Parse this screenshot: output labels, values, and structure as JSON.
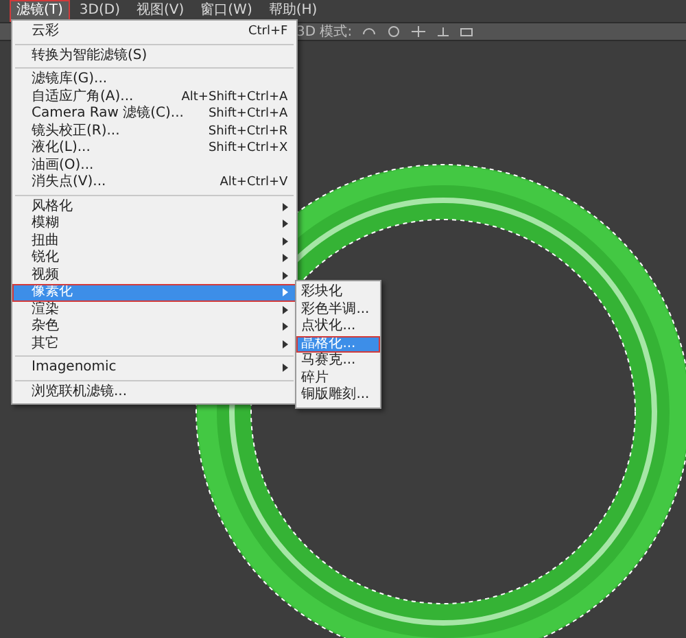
{
  "menubar": [
    {
      "label": "滤镜(T)",
      "selected": true,
      "marked": true
    },
    {
      "label": "3D(D)",
      "selected": false,
      "marked": false
    },
    {
      "label": "视图(V)",
      "selected": false,
      "marked": false
    },
    {
      "label": "窗口(W)",
      "selected": false,
      "marked": false
    },
    {
      "label": "帮助(H)",
      "selected": false,
      "marked": false
    }
  ],
  "toolbar": {
    "label": "3D 模式:"
  },
  "filter_menu": {
    "items": [
      {
        "kind": "item",
        "label": "云彩",
        "shortcut": "Ctrl+F",
        "selected": false,
        "marked": false
      },
      {
        "kind": "separator"
      },
      {
        "kind": "item",
        "label": "转换为智能滤镜(S)",
        "selected": false,
        "marked": false
      },
      {
        "kind": "separator"
      },
      {
        "kind": "item",
        "label": "滤镜库(G)...",
        "selected": false,
        "marked": false
      },
      {
        "kind": "item",
        "label": "自适应广角(A)...",
        "shortcut": "Alt+Shift+Ctrl+A",
        "selected": false,
        "marked": false
      },
      {
        "kind": "item",
        "label": "Camera Raw 滤镜(C)...",
        "shortcut": "Shift+Ctrl+A",
        "selected": false,
        "marked": false
      },
      {
        "kind": "item",
        "label": "镜头校正(R)...",
        "shortcut": "Shift+Ctrl+R",
        "selected": false,
        "marked": false
      },
      {
        "kind": "item",
        "label": "液化(L)...",
        "shortcut": "Shift+Ctrl+X",
        "selected": false,
        "marked": false
      },
      {
        "kind": "item",
        "label": "油画(O)...",
        "selected": false,
        "marked": false
      },
      {
        "kind": "item",
        "label": "消失点(V)...",
        "shortcut": "Alt+Ctrl+V",
        "selected": false,
        "marked": false
      },
      {
        "kind": "separator"
      },
      {
        "kind": "submenu",
        "label": "风格化",
        "selected": false,
        "marked": false
      },
      {
        "kind": "submenu",
        "label": "模糊",
        "selected": false,
        "marked": false
      },
      {
        "kind": "submenu",
        "label": "扭曲",
        "selected": false,
        "marked": false
      },
      {
        "kind": "submenu",
        "label": "锐化",
        "selected": false,
        "marked": false
      },
      {
        "kind": "submenu",
        "label": "视频",
        "selected": false,
        "marked": false
      },
      {
        "kind": "submenu",
        "label": "像素化",
        "selected": true,
        "marked": true
      },
      {
        "kind": "submenu",
        "label": "渲染",
        "selected": false,
        "marked": false
      },
      {
        "kind": "submenu",
        "label": "杂色",
        "selected": false,
        "marked": false
      },
      {
        "kind": "submenu",
        "label": "其它",
        "selected": false,
        "marked": false
      },
      {
        "kind": "separator"
      },
      {
        "kind": "submenu",
        "label": "Imagenomic",
        "selected": false,
        "marked": false
      },
      {
        "kind": "separator"
      },
      {
        "kind": "item",
        "label": "浏览联机滤镜...",
        "selected": false,
        "marked": false
      }
    ]
  },
  "pixelate_submenu": {
    "items": [
      {
        "label": "彩块化",
        "selected": false,
        "marked": false
      },
      {
        "label": "彩色半调...",
        "selected": false,
        "marked": false
      },
      {
        "label": "点状化...",
        "selected": false,
        "marked": false
      },
      {
        "label": "晶格化...",
        "selected": true,
        "marked": true
      },
      {
        "label": "马赛克...",
        "selected": false,
        "marked": false
      },
      {
        "label": "碎片",
        "selected": false,
        "marked": false
      },
      {
        "label": "铜版雕刻...",
        "selected": false,
        "marked": false
      }
    ]
  }
}
